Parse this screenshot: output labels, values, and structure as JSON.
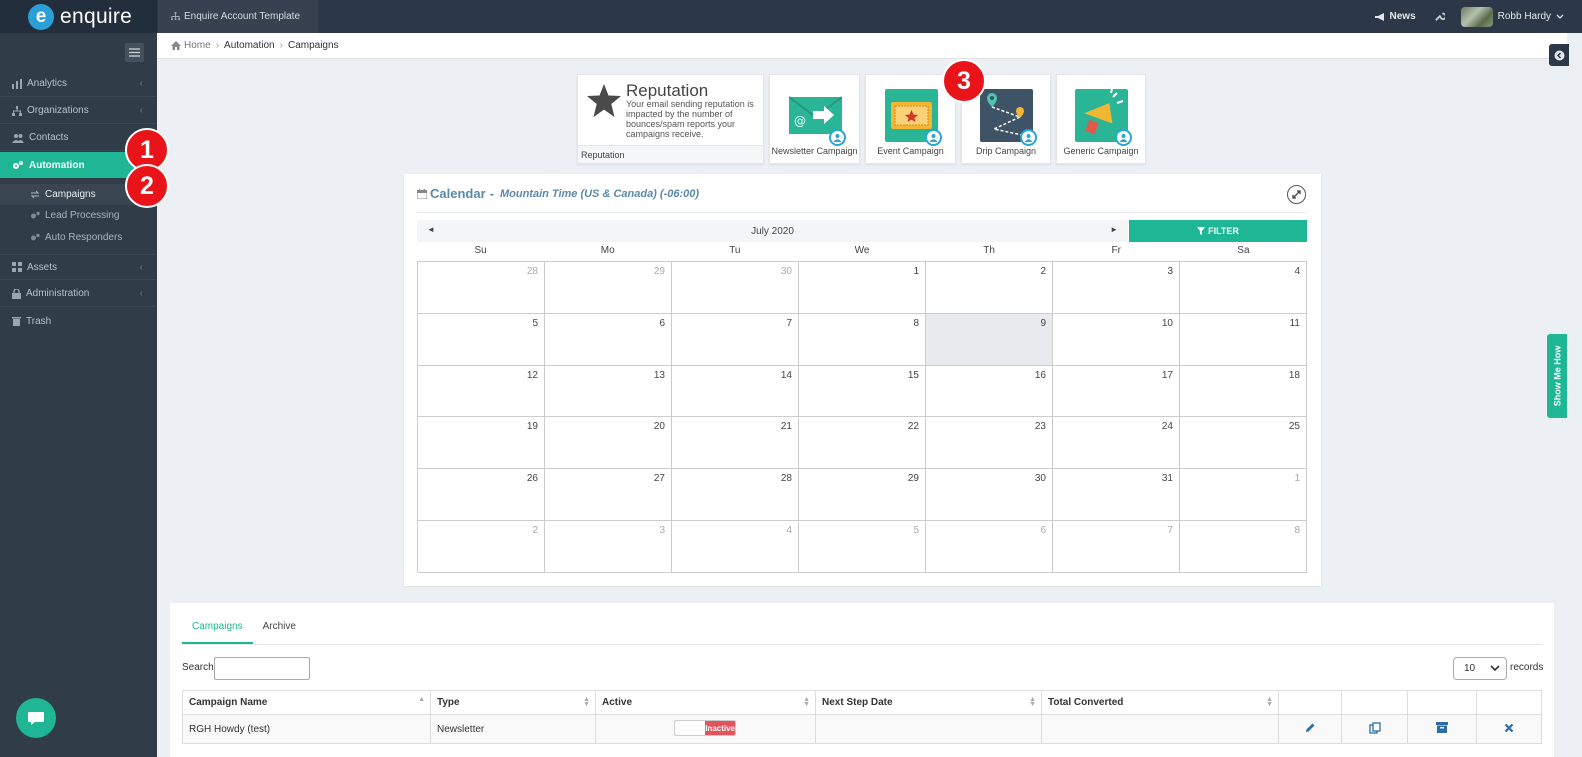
{
  "brand": {
    "name": "enquire",
    "logo_letter": "e",
    "accent": "#1fb696",
    "topbar_color": "#2c3847",
    "sidebar_color": "#313c49"
  },
  "topbar": {
    "account_name": "Enquire Account Template",
    "news_label": "News",
    "user_name": "Robb Hardy"
  },
  "sidebar": {
    "items": [
      {
        "label": "Analytics",
        "icon": "bar-chart-icon"
      },
      {
        "label": "Organizations",
        "icon": "sitemap-icon"
      },
      {
        "label": "Contacts",
        "icon": "users-icon"
      },
      {
        "label": "Automation",
        "icon": "gears-icon",
        "active": true
      },
      {
        "label": "Assets",
        "icon": "grid-icon"
      },
      {
        "label": "Administration",
        "icon": "lock-icon"
      },
      {
        "label": "Trash",
        "icon": "trash-icon"
      }
    ],
    "sub_items": [
      {
        "label": "Campaigns",
        "active": true
      },
      {
        "label": "Lead Processing"
      },
      {
        "label": "Auto Responders"
      }
    ]
  },
  "badges": [
    "1",
    "2",
    "3"
  ],
  "breadcrumb": {
    "home": "Home",
    "section": "Automation",
    "current": "Campaigns"
  },
  "reputation": {
    "title": "Reputation",
    "description": "Your email sending reputation is impacted by the number of bounces/spam reports your campaigns receive.",
    "footer": "Reputation"
  },
  "campaign_tiles": [
    {
      "label": "Newsletter Campaign",
      "icon": "newsletter-icon"
    },
    {
      "label": "Event Campaign",
      "icon": "event-ticket-icon"
    },
    {
      "label": "Drip Campaign",
      "icon": "drip-map-icon"
    },
    {
      "label": "Generic Campaign",
      "icon": "megaphone-icon"
    }
  ],
  "calendar": {
    "title": "Calendar",
    "dash": "-",
    "timezone": "Mountain Time (US & Canada) (-06:00)",
    "month": "July 2020",
    "prev": "◄",
    "next": "►",
    "filter_label": "FILTER",
    "weekdays": [
      "Su",
      "Mo",
      "Tu",
      "We",
      "Th",
      "Fr",
      "Sa"
    ],
    "weeks": [
      [
        {
          "d": "28",
          "o": true
        },
        {
          "d": "29",
          "o": true
        },
        {
          "d": "30",
          "o": true
        },
        {
          "d": "1"
        },
        {
          "d": "2"
        },
        {
          "d": "3"
        },
        {
          "d": "4"
        }
      ],
      [
        {
          "d": "5"
        },
        {
          "d": "6"
        },
        {
          "d": "7"
        },
        {
          "d": "8"
        },
        {
          "d": "9",
          "today": true
        },
        {
          "d": "10"
        },
        {
          "d": "11"
        }
      ],
      [
        {
          "d": "12"
        },
        {
          "d": "13"
        },
        {
          "d": "14"
        },
        {
          "d": "15"
        },
        {
          "d": "16"
        },
        {
          "d": "17"
        },
        {
          "d": "18"
        }
      ],
      [
        {
          "d": "19"
        },
        {
          "d": "20"
        },
        {
          "d": "21"
        },
        {
          "d": "22"
        },
        {
          "d": "23"
        },
        {
          "d": "24"
        },
        {
          "d": "25"
        }
      ],
      [
        {
          "d": "26"
        },
        {
          "d": "27"
        },
        {
          "d": "28"
        },
        {
          "d": "29"
        },
        {
          "d": "30"
        },
        {
          "d": "31"
        },
        {
          "d": "1",
          "o": true
        }
      ],
      [
        {
          "d": "2",
          "o": true
        },
        {
          "d": "3",
          "o": true
        },
        {
          "d": "4",
          "o": true
        },
        {
          "d": "5",
          "o": true
        },
        {
          "d": "6",
          "o": true
        },
        {
          "d": "7",
          "o": true
        },
        {
          "d": "8",
          "o": true
        }
      ]
    ]
  },
  "show_me_how": "Show Me How",
  "table": {
    "tabs": [
      "Campaigns",
      "Archive"
    ],
    "search_label": "Search:",
    "search_value": "",
    "page_size": "10",
    "records_label": "records",
    "columns": [
      "Campaign Name",
      "Type",
      "Active",
      "Next Step Date",
      "Total Converted"
    ],
    "rows": [
      {
        "name": "RGH Howdy (test)",
        "type": "Newsletter",
        "active_label": "Inactive",
        "next_step": "",
        "total_converted": ""
      }
    ]
  }
}
